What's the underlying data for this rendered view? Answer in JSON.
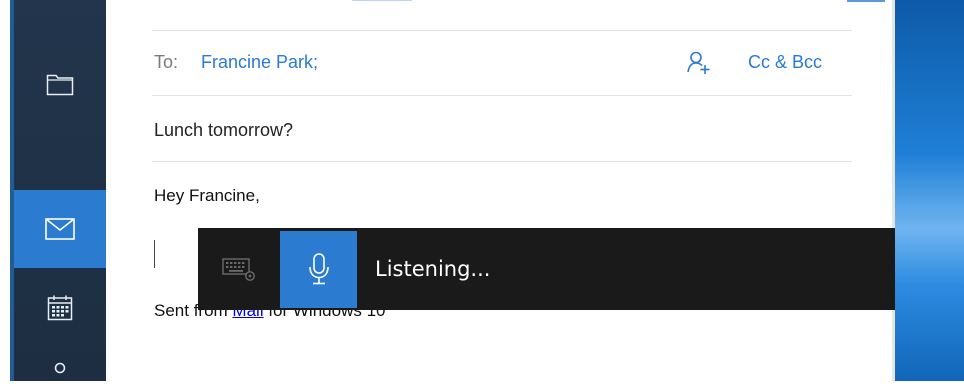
{
  "compose": {
    "to_label": "To:",
    "to_value": "Francine Park;",
    "ccbcc_label": "Cc & Bcc",
    "subject": "Lunch tomorrow?",
    "greeting": "Hey Francine,",
    "signature_prefix": "Sent from ",
    "signature_link": "Mail",
    "signature_suffix": " for Windows 10"
  },
  "dictation": {
    "status": "Listening..."
  },
  "nav": {
    "items": [
      {
        "icon": "folder-icon"
      },
      {
        "icon": "mail-icon",
        "active": true
      },
      {
        "icon": "calendar-icon"
      },
      {
        "icon": "people-icon"
      }
    ]
  },
  "colors": {
    "accent": "#2b7bd0",
    "link": "#2a7ad1",
    "nav_bg": "#22354c",
    "dictation_bg": "#1a1a1a"
  }
}
